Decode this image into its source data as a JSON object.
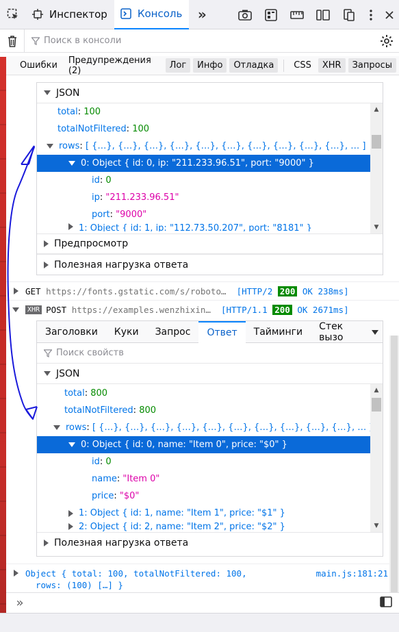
{
  "toolbar": {
    "tabs": [
      {
        "label": "Инспектор",
        "icon": "inspector-icon"
      },
      {
        "label": "Консоль",
        "icon": "console-icon"
      }
    ],
    "more": "»"
  },
  "filter": {
    "placeholder": "Поиск в консоли"
  },
  "levels": {
    "errors": "Ошибки",
    "warnings": "Предупреждения (2)",
    "log": "Лог",
    "info": "Инфо",
    "debug": "Отладка",
    "css": "CSS",
    "xhr": "XHR",
    "requests": "Запросы"
  },
  "first_response": {
    "json_label": "JSON",
    "total_key": "total",
    "total_val": "100",
    "tnf_key": "totalNotFiltered",
    "tnf_val": "100",
    "rows_key": "rows",
    "rows_val": "[ {…}, {…}, {…}, {…}, {…}, {…}, {…}, {…}, {…}, {…}, … ]",
    "row0_label": "0: Object { id: 0, ip: \"211.233.96.51\", port: \"9000\" }",
    "id_key": "id",
    "id_val": "0",
    "ip_key": "ip",
    "ip_val": "\"211.233.96.51\"",
    "port_key": "port",
    "port_val": "\"9000\"",
    "row1_label": "1: Object { id: 1, ip: \"112.73.50.207\", port: \"8181\" }",
    "preview": "Предпросмотр",
    "payload": "Полезная нагрузка ответа"
  },
  "requests": [
    {
      "method": "GET",
      "url": "https://fonts.gstatic.com/s/roboto…",
      "proto": "[HTTP/2",
      "code": "200",
      "status": "OK 238ms]"
    },
    {
      "badge": "XHR",
      "method": "POST",
      "url": "https://examples.wenzhixin…",
      "proto": "[HTTP/1.1",
      "code": "200",
      "status": "OK 2671ms]"
    }
  ],
  "net_tabs": [
    "Заголовки",
    "Куки",
    "Запрос",
    "Ответ",
    "Тайминги",
    "Стек вызо"
  ],
  "props_placeholder": "Поиск свойств",
  "second_response": {
    "json_label": "JSON",
    "total_key": "total",
    "total_val": "800",
    "tnf_key": "totalNotFiltered",
    "tnf_val": "800",
    "rows_key": "rows",
    "rows_val": "[ {…}, {…}, {…}, {…}, {…}, {…}, {…}, {…}, {…}, {…}, … ]",
    "row0_label": "0: Object { id: 0, name: \"Item 0\", price: \"$0\" }",
    "id_key": "id",
    "id_val": "0",
    "name_key": "name",
    "name_val": "\"Item 0\"",
    "price_key": "price",
    "price_val": "\"$0\"",
    "row1_label": "1: Object { id: 1, name: \"Item 1\", price: \"$1\" }",
    "row2_label": "2: Object { id: 2, name: \"Item 2\", price: \"$2\" }",
    "payload": "Полезная нагрузка ответа"
  },
  "log_line": {
    "text1": "Object { total: 100, totalNotFiltered: 100,",
    "text2": "rows: (100) […] }",
    "source": "main.js:181:21"
  },
  "prompt": "»",
  "colors": {
    "accent": "#0a84ff",
    "selection": "#0a6ad9",
    "badge_ok": "#058b00",
    "annotation": "#1a1adb"
  }
}
